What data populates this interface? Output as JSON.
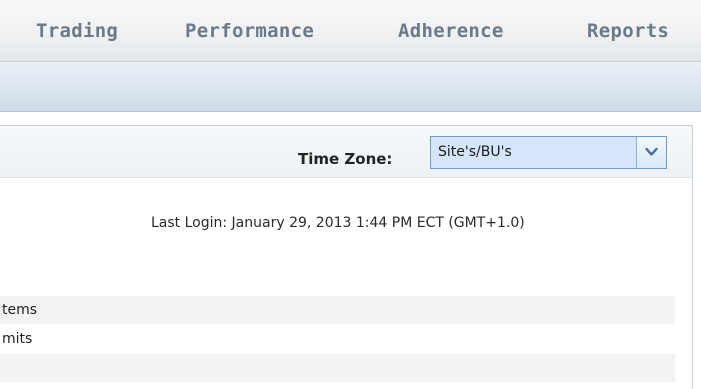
{
  "nav": {
    "items": [
      "Trading",
      "Performance",
      "Adherence",
      "Reports"
    ]
  },
  "timezone": {
    "label": "Time Zone:",
    "selected": "Site's/BU's"
  },
  "last_login": "Last Login: January 29, 2013 1:44 PM ECT (GMT+1.0)",
  "list": {
    "items": [
      "tems",
      "mits",
      ""
    ]
  },
  "colors": {
    "nav_text": "#6b7a88",
    "select_bg": "#d6e6fa",
    "select_border": "#6e9ccc"
  },
  "icons": {
    "dropdown": "chevron-down-icon"
  }
}
